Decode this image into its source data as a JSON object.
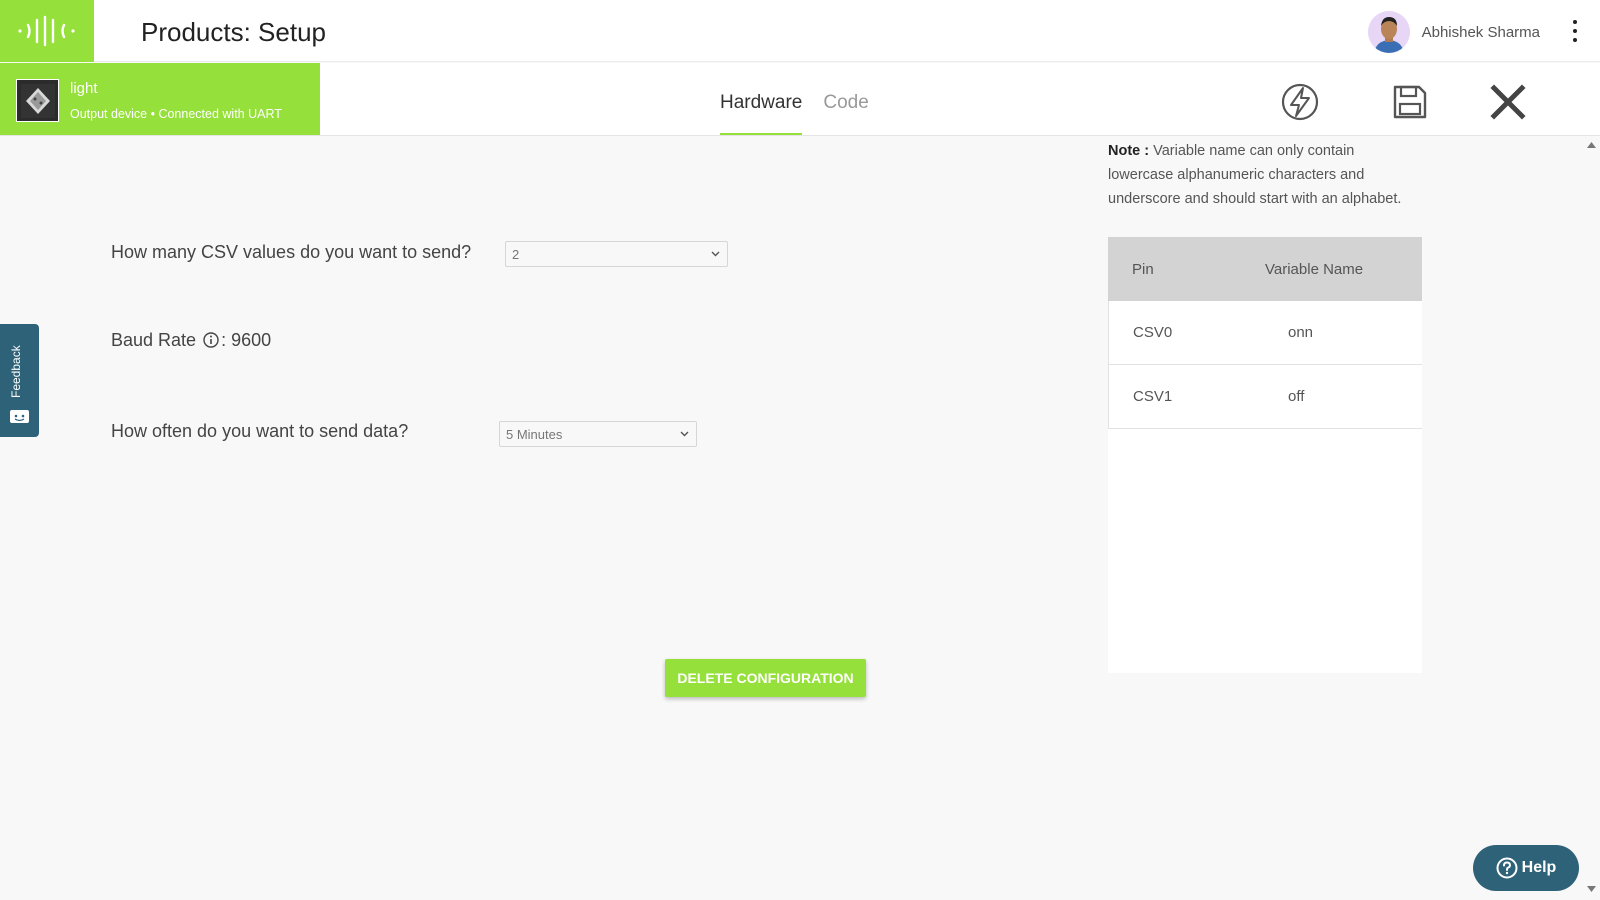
{
  "header": {
    "title": "Products: Setup",
    "user_name": "Abhishek Sharma",
    "logo_icon": "wave-signal-icon",
    "menu_icon": "kebab-menu-icon"
  },
  "device": {
    "name": "light",
    "subtitle": "Output device • Connected with UART"
  },
  "tabs": [
    {
      "label": "Hardware",
      "active": true
    },
    {
      "label": "Code",
      "active": false
    }
  ],
  "toolbar": {
    "icons": [
      "flash-icon",
      "save-icon",
      "close-icon"
    ]
  },
  "feedback": {
    "label": "Feedback"
  },
  "form": {
    "csv_count_label": "How many CSV values do you want to send?",
    "csv_count_value": "2",
    "baud_label": "Baud Rate",
    "baud_value": ": 9600",
    "frequency_label": "How often do you want to send data?",
    "frequency_value": "5 Minutes"
  },
  "delete_button": "DELETE CONFIGURATION",
  "note": {
    "prefix": "Note :",
    "text": "Variable name can only contain lowercase alphanumeric characters and underscore and should start with an alphabet."
  },
  "table": {
    "headers": [
      "Pin",
      "Variable Name"
    ],
    "rows": [
      {
        "pin": "CSV0",
        "variable": "onn"
      },
      {
        "pin": "CSV1",
        "variable": "off"
      }
    ]
  },
  "help": {
    "label": "Help"
  },
  "colors": {
    "accent": "#95e03a",
    "help_bg": "#2e6278",
    "table_header": "#d3d3d3"
  }
}
